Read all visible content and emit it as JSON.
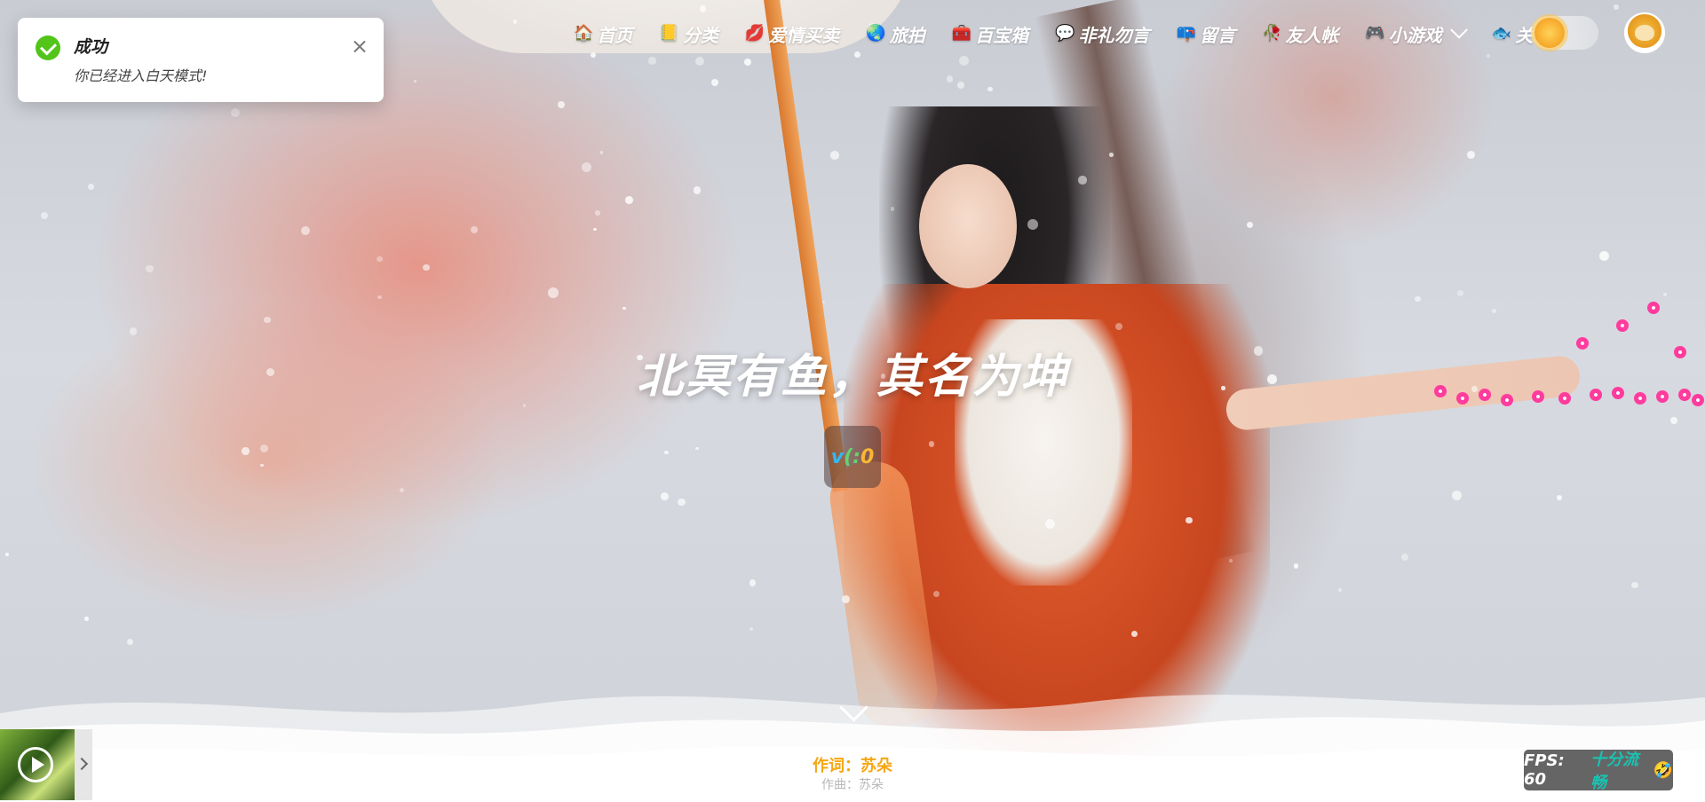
{
  "nav": {
    "items": [
      {
        "icon": "house-icon",
        "glyph": "🏠",
        "label": "首页"
      },
      {
        "icon": "notebook-icon",
        "glyph": "📒",
        "label": "分类"
      },
      {
        "icon": "lips-icon",
        "glyph": "💋",
        "label": "爱情买卖"
      },
      {
        "icon": "globe-icon",
        "glyph": "🌏",
        "label": "旅拍"
      },
      {
        "icon": "toolbox-icon",
        "glyph": "🧰",
        "label": "百宝箱"
      },
      {
        "icon": "speech-bubble-icon",
        "glyph": "💬",
        "label": "非礼勿言"
      },
      {
        "icon": "mailbox-icon",
        "glyph": "📪",
        "label": "留言"
      },
      {
        "icon": "rose-icon",
        "glyph": "🥀",
        "label": "友人帐"
      },
      {
        "icon": "gamepad-icon",
        "glyph": "🎮",
        "label": "小游戏",
        "has_dropdown": true
      },
      {
        "icon": "fish-icon",
        "glyph": "🐟",
        "label": "关于"
      }
    ]
  },
  "theme": {
    "mode": "day",
    "icon": "sun-icon"
  },
  "toast": {
    "title": "成功",
    "message": "你已经进入白天模式!",
    "status_color": "#52c41a"
  },
  "hero": {
    "title": "北冥有鱼，其名为坤",
    "version_parts": [
      "v",
      "(:",
      "0"
    ]
  },
  "player": {
    "lyric": "作词：苏朵",
    "lyric_sub": "作曲：苏朵"
  },
  "fps": {
    "label": "FPS: 60",
    "status": "十分流畅",
    "emoji": "🤣"
  },
  "colors": {
    "accent_orange": "#f5a614",
    "fps_status": "#19c3b3",
    "success": "#52c41a"
  }
}
